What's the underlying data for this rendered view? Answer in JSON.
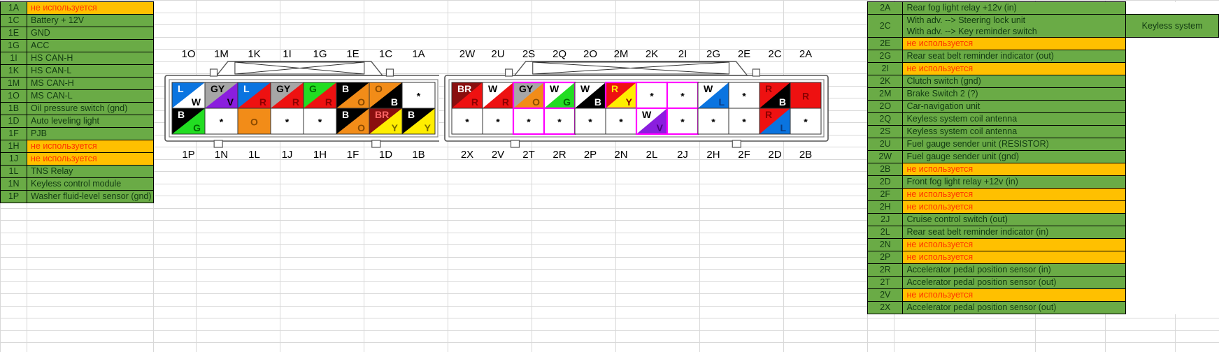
{
  "unused_label": "не используется",
  "left_table": {
    "rows": [
      {
        "code": "1A",
        "desc": "не используется",
        "unused": true
      },
      {
        "code": "1C",
        "desc": "Battery + 12V",
        "unused": false
      },
      {
        "code": "1E",
        "desc": "GND",
        "unused": false
      },
      {
        "code": "1G",
        "desc": "ACC",
        "unused": false
      },
      {
        "code": "1I",
        "desc": "HS CAN-H",
        "unused": false
      },
      {
        "code": "1K",
        "desc": "HS CAN-L",
        "unused": false
      },
      {
        "code": "1M",
        "desc": "MS CAN-H",
        "unused": false
      },
      {
        "code": "1O",
        "desc": "MS CAN-L",
        "unused": false
      },
      {
        "code": "1B",
        "desc": "Oil pressure switch (gnd)",
        "unused": false
      },
      {
        "code": "1D",
        "desc": "Auto leveling light",
        "unused": false
      },
      {
        "code": "1F",
        "desc": "PJB",
        "unused": false
      },
      {
        "code": "1H",
        "desc": "не используется",
        "unused": true
      },
      {
        "code": "1J",
        "desc": "не используется",
        "unused": true
      },
      {
        "code": "1L",
        "desc": "TNS Relay",
        "unused": false
      },
      {
        "code": "1N",
        "desc": "Keyless control module",
        "unused": false
      },
      {
        "code": "1P",
        "desc": "Washer fluid-level sensor (gnd)",
        "unused": false
      }
    ]
  },
  "right_table": {
    "group_label": "Keyless system",
    "rows": [
      {
        "code": "2A",
        "desc": "Rear fog light relay +12v (in)",
        "unused": false
      },
      {
        "code": "2C",
        "desc": "With adv. --> Steering lock unit",
        "desc2": "With adv. --> Key reminder switch",
        "unused": false,
        "group": "Keyless system"
      },
      {
        "code": "2E",
        "desc": "не используется",
        "unused": true
      },
      {
        "code": "2G",
        "desc": "Rear seat belt reminder indicator (out)",
        "unused": false
      },
      {
        "code": "2I",
        "desc": "не используется",
        "unused": true
      },
      {
        "code": "2K",
        "desc": "Clutch switch (gnd)",
        "unused": false
      },
      {
        "code": "2M",
        "desc": "Brake Switch 2 (?)",
        "unused": false
      },
      {
        "code": "2O",
        "desc": "Car-navigation unit",
        "unused": false
      },
      {
        "code": "2Q",
        "desc": "Keyless system coil antenna",
        "unused": false
      },
      {
        "code": "2S",
        "desc": "Keyless system coil antenna",
        "unused": false
      },
      {
        "code": "2U",
        "desc": "Fuel gauge sender unit (RESISTOR)",
        "unused": false
      },
      {
        "code": "2W",
        "desc": "Fuel gauge sender unit (gnd)",
        "unused": false
      },
      {
        "code": "2B",
        "desc": "не используется",
        "unused": true
      },
      {
        "code": "2D",
        "desc": "Front fog light relay +12v (in)",
        "unused": false
      },
      {
        "code": "2F",
        "desc": "не используется",
        "unused": true
      },
      {
        "code": "2H",
        "desc": "не используется",
        "unused": true
      },
      {
        "code": "2J",
        "desc": "Cruise control switch (out)",
        "unused": false
      },
      {
        "code": "2L",
        "desc": "Rear seat belt reminder indicator (in)",
        "unused": false
      },
      {
        "code": "2N",
        "desc": "не используется",
        "unused": true
      },
      {
        "code": "2P",
        "desc": "не используется",
        "unused": true
      },
      {
        "code": "2R",
        "desc": "Accelerator pedal position sensor (in)",
        "unused": false
      },
      {
        "code": "2T",
        "desc": "Accelerator pedal position sensor (out)",
        "unused": false
      },
      {
        "code": "2V",
        "desc": "не используется",
        "unused": true
      },
      {
        "code": "2X",
        "desc": "Accelerator pedal position sensor (out)",
        "unused": false
      }
    ]
  },
  "connector1": {
    "name": "connector-1",
    "top_labels": [
      "1O",
      "1M",
      "1K",
      "1I",
      "1G",
      "1E",
      "1C",
      "1A"
    ],
    "bottom_labels": [
      "1P",
      "1N",
      "1L",
      "1J",
      "1H",
      "1F",
      "1D",
      "1B"
    ],
    "top_cells": [
      {
        "pin": "1O",
        "upper": "L",
        "lower": "W",
        "c1": "#0a74e0",
        "c2": "#ffffff",
        "t1": "#ffffff",
        "t2": "#000000"
      },
      {
        "pin": "1M",
        "upper": "GY",
        "lower": "V",
        "c1": "#a6a6a6",
        "c2": "#8a1ede",
        "t1": "#000000",
        "t2": "#000000"
      },
      {
        "pin": "1K",
        "upper": "L",
        "lower": "R",
        "c1": "#0a74e0",
        "c2": "#ee1111",
        "t1": "#ffffff",
        "t2": "#8a0000"
      },
      {
        "pin": "1I",
        "upper": "GY",
        "lower": "R",
        "c1": "#a6a6a6",
        "c2": "#ee1111",
        "t1": "#000000",
        "t2": "#8a0000"
      },
      {
        "pin": "1G",
        "upper": "G",
        "lower": "R",
        "c1": "#22dd22",
        "c2": "#ee1111",
        "t1": "#006600",
        "t2": "#8a0000"
      },
      {
        "pin": "1E",
        "upper": "B",
        "lower": "O",
        "c1": "#000000",
        "c2": "#f28c18",
        "t1": "#ffffff",
        "t2": "#8a4a00"
      },
      {
        "pin": "1C",
        "upper": "O",
        "lower": "B",
        "c1": "#f28c18",
        "c2": "#000000",
        "t1": "#8a4a00",
        "t2": "#ffffff"
      },
      {
        "pin": "1A",
        "upper": "",
        "lower": "*",
        "c1": "#ffffff",
        "c2": "#ffffff",
        "t1": "#000000",
        "t2": "#000000"
      }
    ],
    "bottom_cells": [
      {
        "pin": "1P",
        "upper": "B",
        "lower": "G",
        "c1": "#000000",
        "c2": "#22dd22",
        "t1": "#ffffff",
        "t2": "#006600"
      },
      {
        "pin": "1N",
        "upper": "",
        "lower": "*",
        "c1": "#ffffff",
        "c2": "#ffffff",
        "t1": "#000000",
        "t2": "#000000"
      },
      {
        "pin": "1L",
        "upper": "",
        "lower": "O",
        "c1": "#f28c18",
        "c2": "#f28c18",
        "t1": "#8a4a00",
        "t2": "#8a4a00"
      },
      {
        "pin": "1J",
        "upper": "",
        "lower": "*",
        "c1": "#ffffff",
        "c2": "#ffffff",
        "t1": "#000000",
        "t2": "#000000"
      },
      {
        "pin": "1H",
        "upper": "",
        "lower": "*",
        "c1": "#ffffff",
        "c2": "#ffffff",
        "t1": "#000000",
        "t2": "#000000"
      },
      {
        "pin": "1F",
        "upper": "B",
        "lower": "O",
        "c1": "#000000",
        "c2": "#f28c18",
        "t1": "#ffffff",
        "t2": "#8a4a00"
      },
      {
        "pin": "1D",
        "upper": "BR",
        "lower": "Y",
        "c1": "#8a0f0f",
        "c2": "#ffee00",
        "t1": "#ff6666",
        "t2": "#7a6a00"
      },
      {
        "pin": "1B",
        "upper": "B",
        "lower": "Y",
        "c1": "#000000",
        "c2": "#ffee00",
        "t1": "#ffffff",
        "t2": "#7a6a00"
      }
    ]
  },
  "connector2": {
    "name": "connector-2",
    "top_labels": [
      "2W",
      "2U",
      "2S",
      "2Q",
      "2O",
      "2M",
      "2K",
      "2I",
      "2G",
      "2E",
      "2C",
      "2A"
    ],
    "bottom_labels": [
      "2X",
      "2V",
      "2T",
      "2R",
      "2P",
      "2N",
      "2L",
      "2J",
      "2H",
      "2F",
      "2D",
      "2B"
    ],
    "top_cells": [
      {
        "pin": "2W",
        "upper": "BR",
        "lower": "R",
        "c1": "#8a0f0f",
        "c2": "#ee1111",
        "t1": "#ffffff",
        "t2": "#8a0000",
        "hl": false
      },
      {
        "pin": "2U",
        "upper": "W",
        "lower": "R",
        "c1": "#ffffff",
        "c2": "#ee1111",
        "t1": "#000000",
        "t2": "#8a0000",
        "hl": false
      },
      {
        "pin": "2S",
        "upper": "GY",
        "lower": "O",
        "c1": "#a6a6a6",
        "c2": "#f28c18",
        "t1": "#000000",
        "t2": "#8a4a00",
        "hl": true
      },
      {
        "pin": "2Q",
        "upper": "W",
        "lower": "G",
        "c1": "#ffffff",
        "c2": "#22dd22",
        "t1": "#000000",
        "t2": "#006600",
        "hl": true
      },
      {
        "pin": "2O",
        "upper": "W",
        "lower": "B",
        "c1": "#ffffff",
        "c2": "#000000",
        "t1": "#000000",
        "t2": "#ffffff",
        "hl": false
      },
      {
        "pin": "2M",
        "upper": "R",
        "lower": "Y",
        "c1": "#ee1111",
        "c2": "#ffee00",
        "t1": "#ffee00",
        "t2": "#8a0000",
        "hl": true
      },
      {
        "pin": "2K",
        "upper": "",
        "lower": "*",
        "c1": "#ffffff",
        "c2": "#ffffff",
        "t1": "#000000",
        "t2": "#000000",
        "hl": true
      },
      {
        "pin": "2I",
        "upper": "",
        "lower": "*",
        "c1": "#ffffff",
        "c2": "#ffffff",
        "t1": "#000000",
        "t2": "#000000",
        "hl": true
      },
      {
        "pin": "2G",
        "upper": "W",
        "lower": "L",
        "c1": "#ffffff",
        "c2": "#0a74e0",
        "t1": "#000000",
        "t2": "#0a3a80",
        "hl": false
      },
      {
        "pin": "2E",
        "upper": "",
        "lower": "*",
        "c1": "#ffffff",
        "c2": "#ffffff",
        "t1": "#000000",
        "t2": "#000000",
        "hl": false
      },
      {
        "pin": "2C",
        "upper": "R",
        "lower": "B",
        "c1": "#ee1111",
        "c2": "#000000",
        "t1": "#8a0000",
        "t2": "#ffffff",
        "hl": false
      },
      {
        "pin": "2A",
        "upper": "",
        "lower": "R",
        "c1": "#ee1111",
        "c2": "#ee1111",
        "t1": "#8a0000",
        "t2": "#8a0000",
        "hl": false
      }
    ],
    "bottom_cells": [
      {
        "pin": "2X",
        "upper": "",
        "lower": "*",
        "c1": "#ffffff",
        "c2": "#ffffff",
        "t1": "#000000",
        "t2": "#000000",
        "hl": false
      },
      {
        "pin": "2V",
        "upper": "",
        "lower": "*",
        "c1": "#ffffff",
        "c2": "#ffffff",
        "t1": "#000000",
        "t2": "#000000",
        "hl": false
      },
      {
        "pin": "2T",
        "upper": "",
        "lower": "*",
        "c1": "#ffffff",
        "c2": "#ffffff",
        "t1": "#000000",
        "t2": "#000000",
        "hl": true
      },
      {
        "pin": "2R",
        "upper": "",
        "lower": "*",
        "c1": "#ffffff",
        "c2": "#ffffff",
        "t1": "#000000",
        "t2": "#000000",
        "hl": true
      },
      {
        "pin": "2P",
        "upper": "",
        "lower": "*",
        "c1": "#ffffff",
        "c2": "#ffffff",
        "t1": "#000000",
        "t2": "#000000",
        "hl": false
      },
      {
        "pin": "2N",
        "upper": "",
        "lower": "*",
        "c1": "#ffffff",
        "c2": "#ffffff",
        "t1": "#000000",
        "t2": "#000000",
        "hl": false
      },
      {
        "pin": "2L",
        "upper": "W",
        "lower": "V",
        "c1": "#ffffff",
        "c2": "#8a1ede",
        "t1": "#000000",
        "t2": "#4a0080",
        "hl": true
      },
      {
        "pin": "2J",
        "upper": "",
        "lower": "*",
        "c1": "#ffffff",
        "c2": "#ffffff",
        "t1": "#000000",
        "t2": "#000000",
        "hl": true
      },
      {
        "pin": "2H",
        "upper": "",
        "lower": "*",
        "c1": "#ffffff",
        "c2": "#ffffff",
        "t1": "#000000",
        "t2": "#000000",
        "hl": false
      },
      {
        "pin": "2F",
        "upper": "",
        "lower": "*",
        "c1": "#ffffff",
        "c2": "#ffffff",
        "t1": "#000000",
        "t2": "#000000",
        "hl": false
      },
      {
        "pin": "2D",
        "upper": "R",
        "lower": "L",
        "c1": "#ee1111",
        "c2": "#0a74e0",
        "t1": "#8a0000",
        "t2": "#0a3a80",
        "hl": false
      },
      {
        "pin": "2B",
        "upper": "",
        "lower": "*",
        "c1": "#ffffff",
        "c2": "#ffffff",
        "t1": "#000000",
        "t2": "#000000",
        "hl": false
      }
    ]
  },
  "colors": {
    "green_cell": "#6aab46",
    "orange_cell": "#ffc000",
    "unused_text": "#ff3300",
    "grid_line": "#d8d8d8",
    "highlight_magenta": "#ff00ff"
  }
}
